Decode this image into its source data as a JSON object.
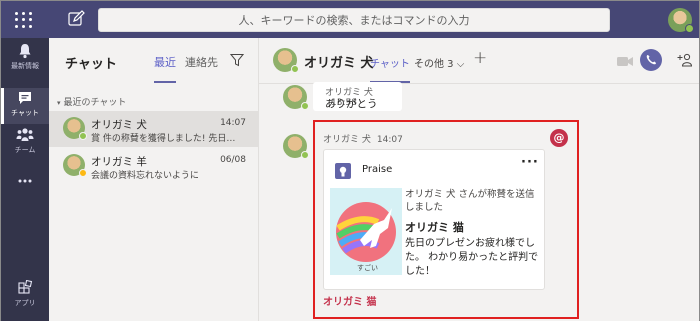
{
  "search": {
    "placeholder": "人、キーワードの検索、またはコマンドの入力"
  },
  "rail": [
    {
      "label": "最新情報",
      "icon": "bell-icon"
    },
    {
      "label": "チャット",
      "icon": "chat-icon"
    },
    {
      "label": "チーム",
      "icon": "teams-icon"
    },
    {
      "label": "",
      "icon": "more-icon"
    },
    {
      "label": "アプリ",
      "icon": "apps-icon"
    }
  ],
  "chatlist": {
    "title": "チャット",
    "tabs": [
      "最近",
      "連絡先"
    ],
    "section": "最近のチャット",
    "chats": [
      {
        "name": "オリガミ 犬",
        "time": "14:07",
        "preview": "賞 件の称賛を獲得しました! 先日の...",
        "status_color": "#92c353"
      },
      {
        "name": "オリガミ 羊",
        "time": "06/08",
        "preview": "会議の資料忘れないように",
        "status_color": "#fdb913"
      }
    ]
  },
  "conversation": {
    "name": "オリガミ 犬",
    "tab_chat": "チャット",
    "tab_more": "その他 3",
    "messages": [
      {
        "sender": "オリガミ 犬",
        "time": "13:58",
        "text": "ありがとう"
      },
      {
        "sender": "オリガミ 犬",
        "time": "14:07"
      }
    ],
    "mention_glyph": "@",
    "card": {
      "app_name": "Praise",
      "sender_line": "オリガミ 犬 さんが称賛を送信しました",
      "recipient": "オリガミ 猫",
      "body": "先日のプレゼンお疲れ様でした。 わかり易かったと評判でした！",
      "badge_caption": "すごい",
      "footer_link": "オリガミ 猫"
    }
  },
  "colors": {
    "accent": "#6264a7",
    "topbar": "#464775",
    "rail": "#33344a",
    "highlight": "#e02020",
    "mention": "#c4314b"
  }
}
